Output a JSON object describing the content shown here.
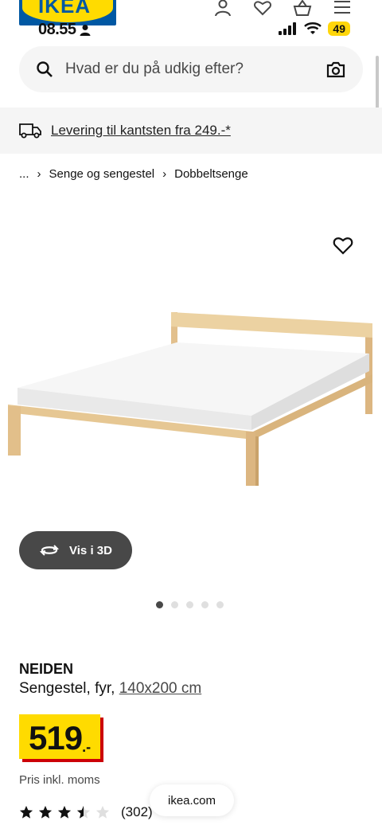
{
  "status_bar": {
    "time": "08.55",
    "battery": "49"
  },
  "header": {
    "logo_text": "IKEA"
  },
  "search": {
    "placeholder": "Hvad er du på udkig efter?"
  },
  "banner": {
    "text": "Levering til kantsten fra 249.-*"
  },
  "breadcrumb": {
    "items": [
      "...",
      "Senge og sengestel",
      "Dobbeltsenge"
    ]
  },
  "gallery": {
    "view3d_label": "Vis i 3D",
    "image_count": 5,
    "active_index": 0
  },
  "product": {
    "name": "NEIDEN",
    "description": "Sengestel, fyr,",
    "size": "140x200 cm",
    "price": "519",
    "currency_suffix": ".-",
    "vat_note": "Pris inkl. moms",
    "rating": 3.5,
    "review_count": "(302)"
  },
  "browser": {
    "url": "ikea.com"
  },
  "colors": {
    "brand_blue": "#0058a3",
    "brand_yellow": "#ffdb00",
    "price_red": "#cc0008"
  }
}
